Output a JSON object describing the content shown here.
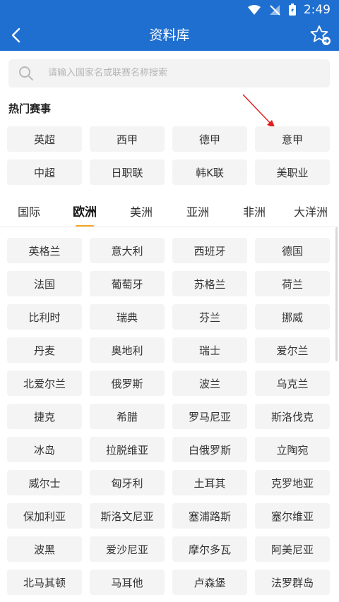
{
  "status": {
    "time": "2:49"
  },
  "header": {
    "title": "资料库"
  },
  "search": {
    "placeholder": "请输入国家名或联赛名称搜索"
  },
  "hot": {
    "title": "热门赛事",
    "items": [
      "英超",
      "西甲",
      "德甲",
      "意甲",
      "中超",
      "日职联",
      "韩K联",
      "美职业"
    ]
  },
  "tabs": [
    "国际",
    "欧洲",
    "美洲",
    "亚洲",
    "非洲",
    "大洋洲"
  ],
  "active_tab": "欧洲",
  "countries": [
    "英格兰",
    "意大利",
    "西班牙",
    "德国",
    "法国",
    "葡萄牙",
    "苏格兰",
    "荷兰",
    "比利时",
    "瑞典",
    "芬兰",
    "挪威",
    "丹麦",
    "奥地利",
    "瑞士",
    "爱尔兰",
    "北爱尔兰",
    "俄罗斯",
    "波兰",
    "乌克兰",
    "捷克",
    "希腊",
    "罗马尼亚",
    "斯洛伐克",
    "冰岛",
    "拉脱维亚",
    "白俄罗斯",
    "立陶宛",
    "威尔士",
    "匈牙利",
    "土耳其",
    "克罗地亚",
    "保加利亚",
    "斯洛文尼亚",
    "塞浦路斯",
    "塞尔维亚",
    "波黑",
    "爱沙尼亚",
    "摩尔多瓦",
    "阿美尼亚",
    "北马其顿",
    "马耳他",
    "卢森堡",
    "法罗群岛"
  ],
  "colors": {
    "header_bg": "#1f6fd0",
    "tab_indicator": "#f5a623",
    "annotation_arrow": "#e02020"
  }
}
